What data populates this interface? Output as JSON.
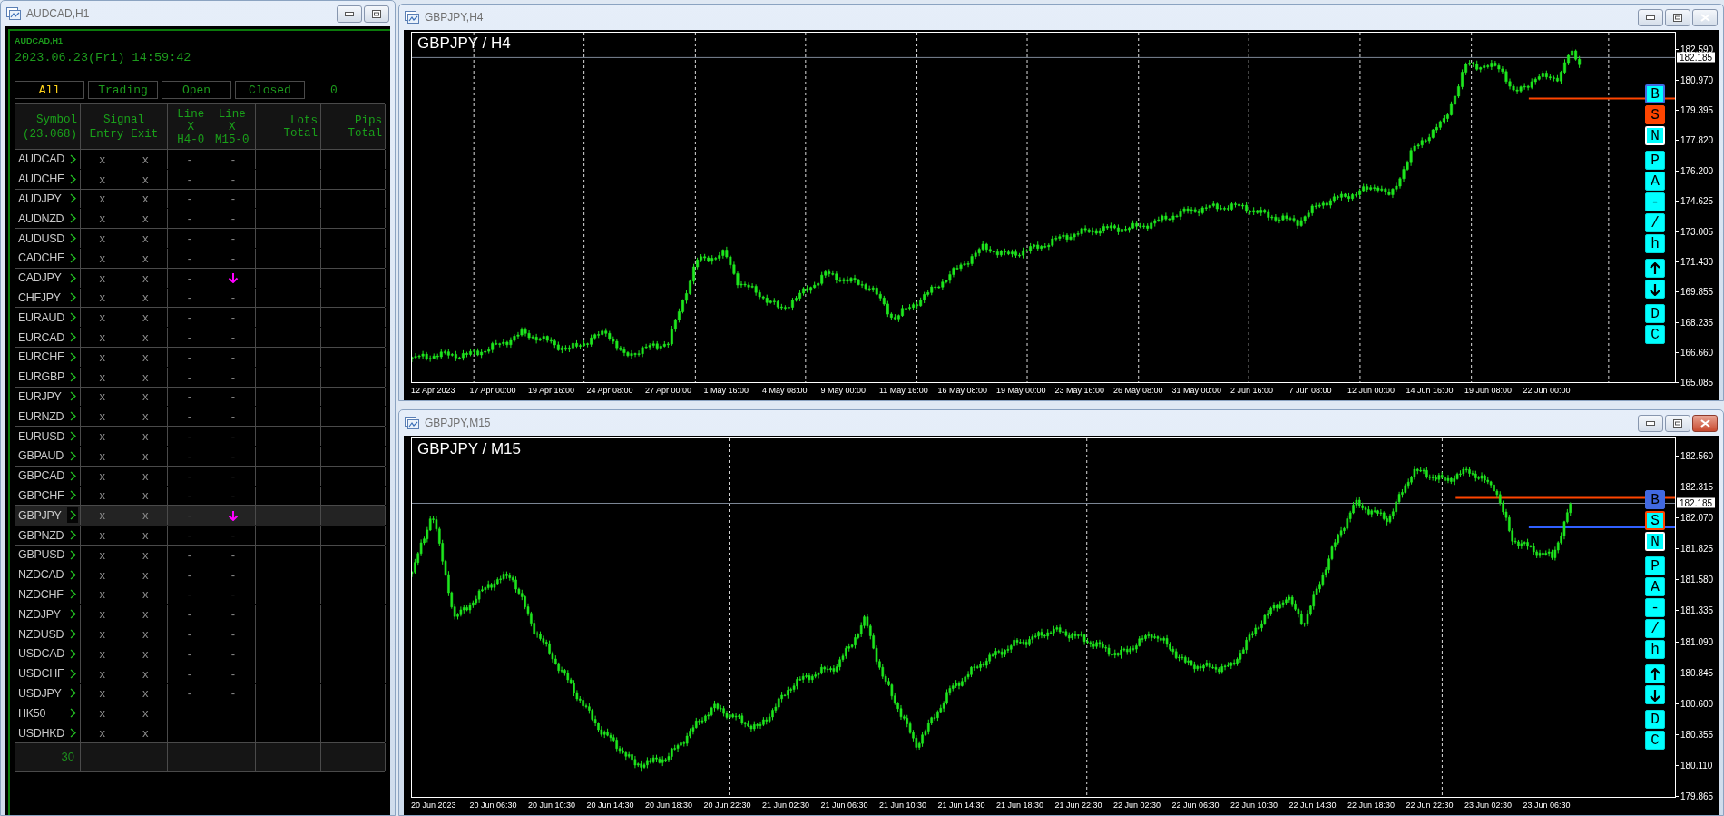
{
  "left_window": {
    "title": "AUDCAD,H1",
    "panel": {
      "caption": "AUDCAD,H1",
      "datetime": "2023.06.23(Fri) 14:59:42",
      "filters": [
        {
          "label": "All",
          "selected": true
        },
        {
          "label": "Trading",
          "selected": false
        },
        {
          "label": "Open",
          "selected": false
        },
        {
          "label": "Closed",
          "selected": false
        }
      ],
      "count": "0",
      "header": {
        "symbol": "Symbol",
        "symbol_sub": "(23.068)",
        "signal": "Signal",
        "entry": "Entry",
        "exit": "Exit",
        "line_h4": "Line X H4-0",
        "line_m15": "Line X M15-0",
        "lots": "Lots Total",
        "pips": "Pips Total"
      },
      "rows": [
        {
          "symbol": "AUDCAD",
          "entry": "x",
          "exit": "x",
          "line_h4": "-",
          "line_m15": "-",
          "selected": false
        },
        {
          "symbol": "AUDCHF",
          "entry": "x",
          "exit": "x",
          "line_h4": "-",
          "line_m15": "-",
          "selected": false
        },
        {
          "symbol": "AUDJPY",
          "entry": "x",
          "exit": "x",
          "line_h4": "-",
          "line_m15": "-",
          "selected": false
        },
        {
          "symbol": "AUDNZD",
          "entry": "x",
          "exit": "x",
          "line_h4": "-",
          "line_m15": "-",
          "selected": false
        },
        {
          "symbol": "AUDUSD",
          "entry": "x",
          "exit": "x",
          "line_h4": "-",
          "line_m15": "-",
          "selected": false
        },
        {
          "symbol": "CADCHF",
          "entry": "x",
          "exit": "x",
          "line_h4": "-",
          "line_m15": "-",
          "selected": false
        },
        {
          "symbol": "CADJPY",
          "entry": "x",
          "exit": "x",
          "line_h4": "-",
          "kind": "signal",
          "selected": false
        },
        {
          "symbol": "CHFJPY",
          "entry": "x",
          "exit": "x",
          "line_h4": "-",
          "line_m15": "-",
          "selected": false
        },
        {
          "symbol": "EURAUD",
          "entry": "x",
          "exit": "x",
          "line_h4": "-",
          "line_m15": "-",
          "selected": false
        },
        {
          "symbol": "EURCAD",
          "entry": "x",
          "exit": "x",
          "line_h4": "-",
          "line_m15": "-",
          "selected": false
        },
        {
          "symbol": "EURCHF",
          "entry": "x",
          "exit": "x",
          "line_h4": "-",
          "line_m15": "-",
          "selected": false
        },
        {
          "symbol": "EURGBP",
          "entry": "x",
          "exit": "x",
          "line_h4": "-",
          "line_m15": "-",
          "selected": false
        },
        {
          "symbol": "EURJPY",
          "entry": "x",
          "exit": "x",
          "line_h4": "-",
          "line_m15": "-",
          "selected": false
        },
        {
          "symbol": "EURNZD",
          "entry": "x",
          "exit": "x",
          "line_h4": "-",
          "line_m15": "-",
          "selected": false
        },
        {
          "symbol": "EURUSD",
          "entry": "x",
          "exit": "x",
          "line_h4": "-",
          "line_m15": "-",
          "selected": false
        },
        {
          "symbol": "GBPAUD",
          "entry": "x",
          "exit": "x",
          "line_h4": "-",
          "line_m15": "-",
          "selected": false
        },
        {
          "symbol": "GBPCAD",
          "entry": "x",
          "exit": "x",
          "line_h4": "-",
          "line_m15": "-",
          "selected": false
        },
        {
          "symbol": "GBPCHF",
          "entry": "x",
          "exit": "x",
          "line_h4": "-",
          "line_m15": "-",
          "selected": false
        },
        {
          "symbol": "GBPJPY",
          "entry": "x",
          "exit": "x",
          "line_h4": "-",
          "kind": "signal",
          "selected": true
        },
        {
          "symbol": "GBPNZD",
          "entry": "x",
          "exit": "x",
          "line_h4": "-",
          "line_m15": "-",
          "selected": false
        },
        {
          "symbol": "GBPUSD",
          "entry": "x",
          "exit": "x",
          "line_h4": "-",
          "line_m15": "-",
          "selected": false
        },
        {
          "symbol": "NZDCAD",
          "entry": "x",
          "exit": "x",
          "line_h4": "-",
          "line_m15": "-",
          "selected": false
        },
        {
          "symbol": "NZDCHF",
          "entry": "x",
          "exit": "x",
          "line_h4": "-",
          "line_m15": "-",
          "selected": false
        },
        {
          "symbol": "NZDJPY",
          "entry": "x",
          "exit": "x",
          "line_h4": "-",
          "line_m15": "-",
          "selected": false
        },
        {
          "symbol": "NZDUSD",
          "entry": "x",
          "exit": "x",
          "line_h4": "-",
          "line_m15": "-",
          "selected": false
        },
        {
          "symbol": "USDCAD",
          "entry": "x",
          "exit": "x",
          "line_h4": "-",
          "line_m15": "-",
          "selected": false
        },
        {
          "symbol": "USDCHF",
          "entry": "x",
          "exit": "x",
          "line_h4": "-",
          "line_m15": "-",
          "selected": false
        },
        {
          "symbol": "USDJPY",
          "entry": "x",
          "exit": "x",
          "line_h4": "-",
          "line_m15": "-",
          "selected": false
        },
        {
          "symbol": "HK50",
          "entry": "x",
          "exit": "x",
          "selected": false
        },
        {
          "symbol": "USDHKD",
          "entry": "x",
          "exit": "x",
          "selected": false
        }
      ],
      "footer": "30"
    }
  },
  "chart_windows": [
    {
      "title": "GBPJPY,H4",
      "active": false,
      "chart_title": "GBPJPY / H4",
      "price_tag": "182.185",
      "y_axis": [
        "182.590",
        "180.970",
        "179.395",
        "177.820",
        "176.200",
        "174.625",
        "173.005",
        "171.430",
        "169.855",
        "168.235",
        "166.660",
        "165.085"
      ],
      "x_axis": [
        "12 Apr 2023",
        "17 Apr 00:00",
        "19 Apr 16:00",
        "24 Apr 08:00",
        "27 Apr 00:00",
        "1 May 16:00",
        "4 May 08:00",
        "9 May 00:00",
        "11 May 16:00",
        "16 May 08:00",
        "19 May 00:00",
        "23 May 16:00",
        "26 May 08:00",
        "31 May 00:00",
        "2 Jun 16:00",
        "7 Jun 08:00",
        "12 Jun 00:00",
        "14 Jun 16:00",
        "19 Jun 08:00",
        "22 Jun 00:00"
      ],
      "side_buttons": [
        [
          {
            "kind": "text",
            "label": "B",
            "color": "#4169e1",
            "selected": false
          },
          {
            "kind": "text",
            "label": "S",
            "color": "#ff4500",
            "selected": true
          },
          {
            "kind": "text",
            "label": "N",
            "color": "#ffffff",
            "selected": false
          }
        ],
        [
          {
            "kind": "text",
            "label": "P",
            "selected": false
          },
          {
            "kind": "text",
            "label": "A",
            "selected": false
          },
          {
            "kind": "text",
            "label": "-",
            "selected": false
          },
          {
            "kind": "text",
            "label": "/",
            "selected": false
          },
          {
            "kind": "text",
            "label": "h",
            "selected": false
          }
        ],
        [
          {
            "kind": "arrow_up",
            "selected": false
          },
          {
            "kind": "arrow_down",
            "selected": false
          }
        ],
        [
          {
            "kind": "text",
            "label": "D",
            "selected": false
          },
          {
            "kind": "text",
            "label": "C",
            "selected": false
          }
        ]
      ]
    },
    {
      "title": "GBPJPY,M15",
      "active": true,
      "chart_title": "GBPJPY / M15",
      "price_tag": "182.185",
      "y_axis": [
        "182.560",
        "182.315",
        "182.070",
        "181.825",
        "181.580",
        "181.335",
        "181.090",
        "180.845",
        "180.600",
        "180.355",
        "180.110",
        "179.865"
      ],
      "x_axis": [
        "20 Jun 2023",
        "20 Jun 06:30",
        "20 Jun 10:30",
        "20 Jun 14:30",
        "20 Jun 18:30",
        "20 Jun 22:30",
        "21 Jun 02:30",
        "21 Jun 06:30",
        "21 Jun 10:30",
        "21 Jun 14:30",
        "21 Jun 18:30",
        "21 Jun 22:30",
        "22 Jun 02:30",
        "22 Jun 06:30",
        "22 Jun 10:30",
        "22 Jun 14:30",
        "22 Jun 18:30",
        "22 Jun 22:30",
        "23 Jun 02:30",
        "23 Jun 06:30"
      ],
      "side_buttons": [
        [
          {
            "kind": "text",
            "label": "B",
            "color": "#4169e1",
            "selected": true
          },
          {
            "kind": "text",
            "label": "S",
            "color": "#ff4500",
            "selected": false
          },
          {
            "kind": "text",
            "label": "N",
            "color": "#ffffff",
            "selected": false
          }
        ],
        [
          {
            "kind": "text",
            "label": "P",
            "selected": false
          },
          {
            "kind": "text",
            "label": "A",
            "selected": false
          },
          {
            "kind": "text",
            "label": "-",
            "selected": false
          },
          {
            "kind": "text",
            "label": "/",
            "selected": false
          },
          {
            "kind": "text",
            "label": "h",
            "selected": false
          }
        ],
        [
          {
            "kind": "arrow_up",
            "selected": false
          },
          {
            "kind": "arrow_down",
            "selected": false
          }
        ],
        [
          {
            "kind": "text",
            "label": "D",
            "selected": false
          },
          {
            "kind": "text",
            "label": "C",
            "selected": false
          }
        ]
      ]
    }
  ]
}
